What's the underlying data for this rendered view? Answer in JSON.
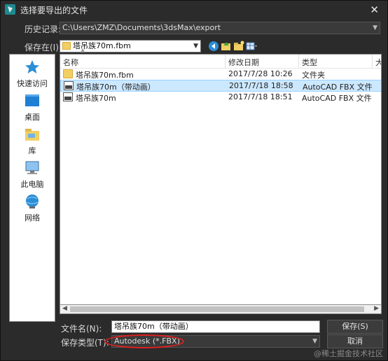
{
  "window": {
    "title": "选择要导出的文件",
    "close_glyph": "✕"
  },
  "history": {
    "label": "历史记录:",
    "value": "C:\\Users\\ZMZ\\Documents\\3dsMax\\export"
  },
  "save_in": {
    "label": "保存在(I):",
    "value": "塔吊族70m.fbm"
  },
  "toolbar_icons": [
    "back-icon",
    "up-folder-icon",
    "new-folder-icon",
    "view-menu-icon"
  ],
  "places": [
    {
      "label": "快速访问",
      "icon": "star-icon"
    },
    {
      "label": "桌面",
      "icon": "desktop-icon"
    },
    {
      "label": "库",
      "icon": "library-icon"
    },
    {
      "label": "此电脑",
      "icon": "computer-icon"
    },
    {
      "label": "网络",
      "icon": "network-icon"
    }
  ],
  "file_list": {
    "columns": [
      "名称",
      "修改日期",
      "类型",
      "大"
    ],
    "rows": [
      {
        "name": "塔吊族70m.fbm",
        "date": "2017/7/28 10:26",
        "type": "文件夹",
        "icon": "folder-icon",
        "selected": false
      },
      {
        "name": "塔吊族70m（带动画）",
        "date": "2017/7/18 18:58",
        "type": "AutoCAD FBX 文件",
        "icon": "fbx-file-icon",
        "selected": true
      },
      {
        "name": "塔吊族70m",
        "date": "2017/7/18 18:51",
        "type": "AutoCAD FBX 文件",
        "icon": "fbx-file-icon",
        "selected": false
      }
    ]
  },
  "filename": {
    "label": "文件名(N):",
    "value": "塔吊族70m（带动画）"
  },
  "filetype": {
    "label": "保存类型(T):",
    "value": "Autodesk (*.FBX)"
  },
  "buttons": {
    "save": "保存(S)",
    "cancel": "取消"
  },
  "watermark": "@稀土掘金技术社区",
  "colors": {
    "selection": "#cce8ff",
    "annotation": "#e02020",
    "dialog_bg": "#2b2b2b"
  }
}
